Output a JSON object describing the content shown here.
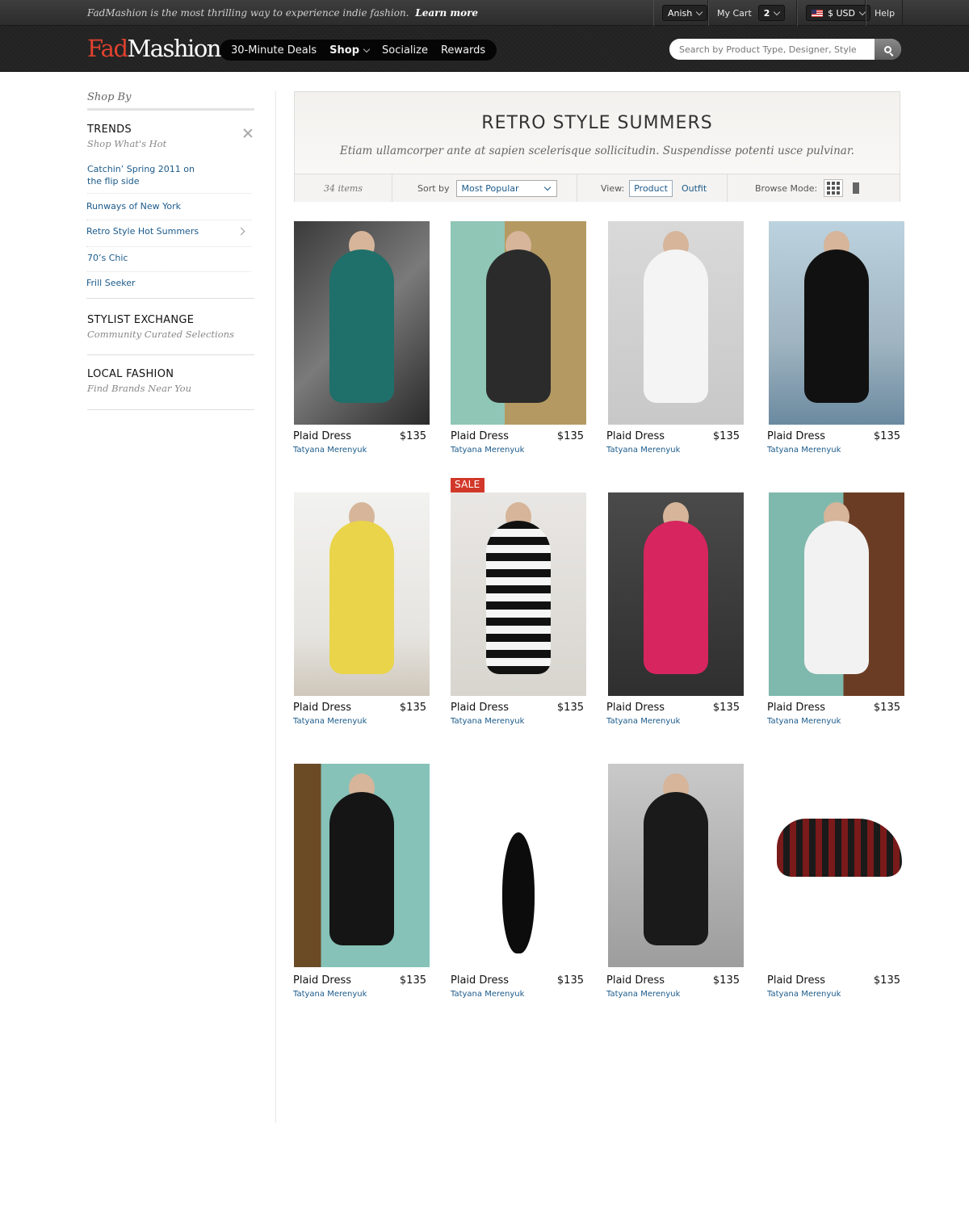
{
  "topbar": {
    "promo_text": "FadMashion is the most thrilling way to experience indie fashion.",
    "promo_link": "Learn more",
    "user_name": "Anish",
    "cart_label": "My Cart",
    "cart_count": "2",
    "currency": "$ USD",
    "help_label": "Help"
  },
  "header": {
    "logo_part1": "Fad",
    "logo_part2": "Mashion",
    "nav": [
      "30-Minute Deals",
      "Shop",
      "Socialize",
      "Rewards"
    ],
    "search_placeholder": "Search by Product Type, Designer, Style"
  },
  "sidebar": {
    "heading": "Shop By",
    "trends_title": "TRENDS",
    "trends_sub": "Shop What's Hot",
    "trend_links": [
      "Catchin’ Spring 2011 on the flip side",
      "Runways of New York",
      "Retro Style Hot Summers",
      "70’s Chic",
      "Frill Seeker"
    ],
    "stylist_title": "STYLIST EXCHANGE",
    "stylist_sub": "Community Curated Selections",
    "local_title": "LOCAL FASHION",
    "local_sub": "Find Brands Near You"
  },
  "banner": {
    "title": "RETRO STYLE SUMMERS",
    "subtitle": "Etiam ullamcorper ante at sapien scelerisque sollicitudin. Suspendisse potenti usce pulvinar."
  },
  "toolbar": {
    "item_count": "34 items",
    "sort_label": "Sort by",
    "sort_value": "Most Popular",
    "view_label": "View:",
    "view_product": "Product",
    "view_outfit": "Outfit",
    "browse_label": "Browse Mode:"
  },
  "products": [
    {
      "name": "Plaid Dress",
      "price": "$135",
      "designer": "Tatyana Merenyuk"
    },
    {
      "name": "Plaid Dress",
      "price": "$135",
      "designer": "Tatyana Merenyuk"
    },
    {
      "name": "Plaid Dress",
      "price": "$135",
      "designer": "Tatyana Merenyuk"
    },
    {
      "name": "Plaid Dress",
      "price": "$135",
      "designer": "Tatyana Merenyuk"
    },
    {
      "name": "Plaid Dress",
      "price": "$135",
      "designer": "Tatyana Merenyuk"
    },
    {
      "name": "Plaid Dress",
      "price": "$135",
      "designer": "Tatyana Merenyuk",
      "badge": "SALE"
    },
    {
      "name": "Plaid Dress",
      "price": "$135",
      "designer": "Tatyana Merenyuk"
    },
    {
      "name": "Plaid Dress",
      "price": "$135",
      "designer": "Tatyana Merenyuk"
    },
    {
      "name": "Plaid Dress",
      "price": "$135",
      "designer": "Tatyana Merenyuk"
    },
    {
      "name": "Plaid Dress",
      "price": "$135",
      "designer": "Tatyana Merenyuk"
    },
    {
      "name": "Plaid Dress",
      "price": "$135",
      "designer": "Tatyana Merenyuk"
    },
    {
      "name": "Plaid Dress",
      "price": "$135",
      "designer": "Tatyana Merenyuk"
    }
  ],
  "colors": {
    "brand_red": "#e2422e",
    "link_blue": "#1b5a8a",
    "sale_red": "#d2382a"
  }
}
